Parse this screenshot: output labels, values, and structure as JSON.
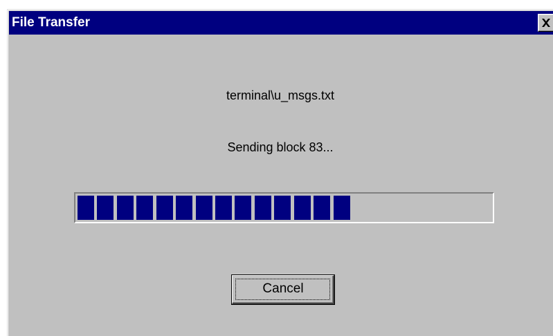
{
  "window": {
    "title": "File Transfer",
    "close_icon": "close-x-icon"
  },
  "transfer": {
    "filename": "terminal\\u_msgs.txt",
    "status": "Sending block 83..."
  },
  "progress": {
    "filled_blocks": 14,
    "total_blocks": 21,
    "fill_color": "#000080"
  },
  "buttons": {
    "cancel_label": "Cancel"
  },
  "colors": {
    "titlebar": "#000080",
    "face": "#c0c0c0"
  }
}
